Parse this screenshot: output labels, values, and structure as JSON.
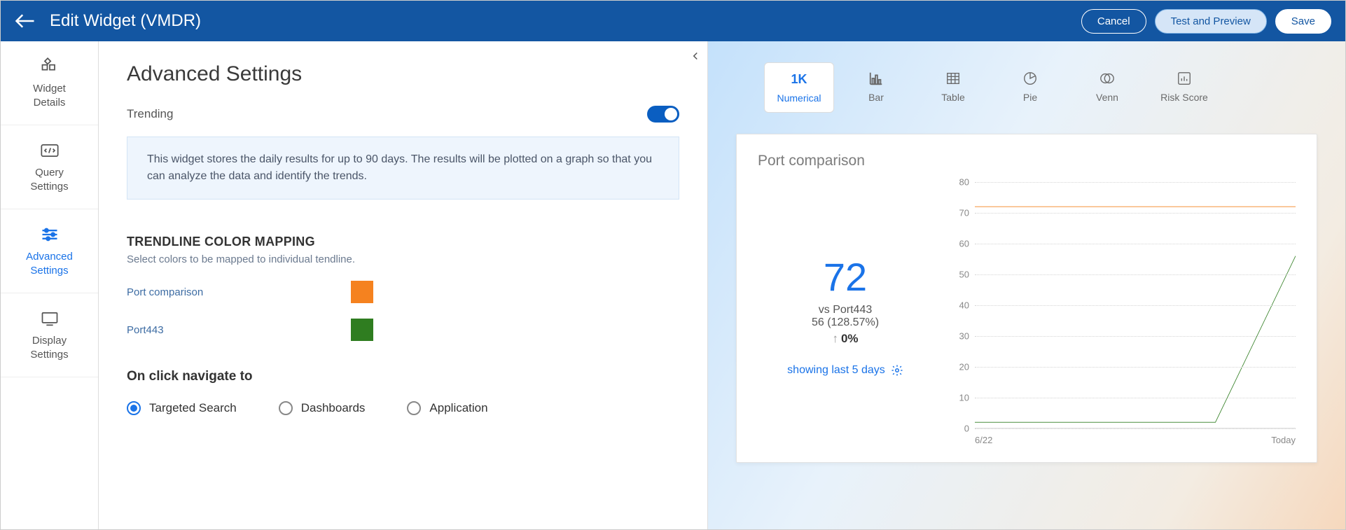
{
  "header": {
    "title": "Edit Widget (VMDR)",
    "cancel": "Cancel",
    "test": "Test and Preview",
    "save": "Save"
  },
  "sidebar": {
    "items": [
      {
        "label": "Widget\nDetails"
      },
      {
        "label": "Query\nSettings"
      },
      {
        "label": "Advanced\nSettings"
      },
      {
        "label": "Display\nSettings"
      }
    ]
  },
  "settings": {
    "title": "Advanced Settings",
    "trending_label": "Trending",
    "info": "This widget stores the daily results for up to 90 days. The results will be plotted on a graph so that you can analyze the data and identify the trends.",
    "color_section_head": "TRENDLINE COLOR MAPPING",
    "color_section_sub": "Select colors to be mapped to individual tendline.",
    "color_rows": [
      {
        "label": "Port comparison",
        "color": "#f5821f"
      },
      {
        "label": "Port443",
        "color": "#2f7d20"
      }
    ],
    "nav_head": "On click navigate to",
    "nav_options": [
      {
        "label": "Targeted Search",
        "checked": true
      },
      {
        "label": "Dashboards",
        "checked": false
      },
      {
        "label": "Application",
        "checked": false
      }
    ]
  },
  "preview": {
    "chart_types": [
      {
        "label": "Numerical",
        "icon_text": "1K",
        "active": true
      },
      {
        "label": "Bar"
      },
      {
        "label": "Table"
      },
      {
        "label": "Pie"
      },
      {
        "label": "Venn"
      },
      {
        "label": "Risk Score"
      }
    ],
    "card": {
      "title": "Port comparison",
      "big_number": "72",
      "vs_line": "vs Port443",
      "pct_line": "56 (128.57%)",
      "delta": "0%",
      "showing": "showing last 5 days"
    }
  },
  "chart_data": {
    "type": "line",
    "title": "Port comparison",
    "xlabel": "",
    "ylabel": "",
    "ylim": [
      0,
      80
    ],
    "x_ticks": [
      "6/22",
      "Today"
    ],
    "y_ticks": [
      0,
      10,
      20,
      30,
      40,
      50,
      60,
      70,
      80
    ],
    "x": [
      0,
      1,
      2,
      3,
      4
    ],
    "series": [
      {
        "name": "Port comparison",
        "color": "#f5821f",
        "values": [
          72,
          72,
          72,
          72,
          72
        ]
      },
      {
        "name": "Port443",
        "color": "#2f7d20",
        "values": [
          2,
          2,
          2,
          2,
          56
        ]
      }
    ]
  }
}
